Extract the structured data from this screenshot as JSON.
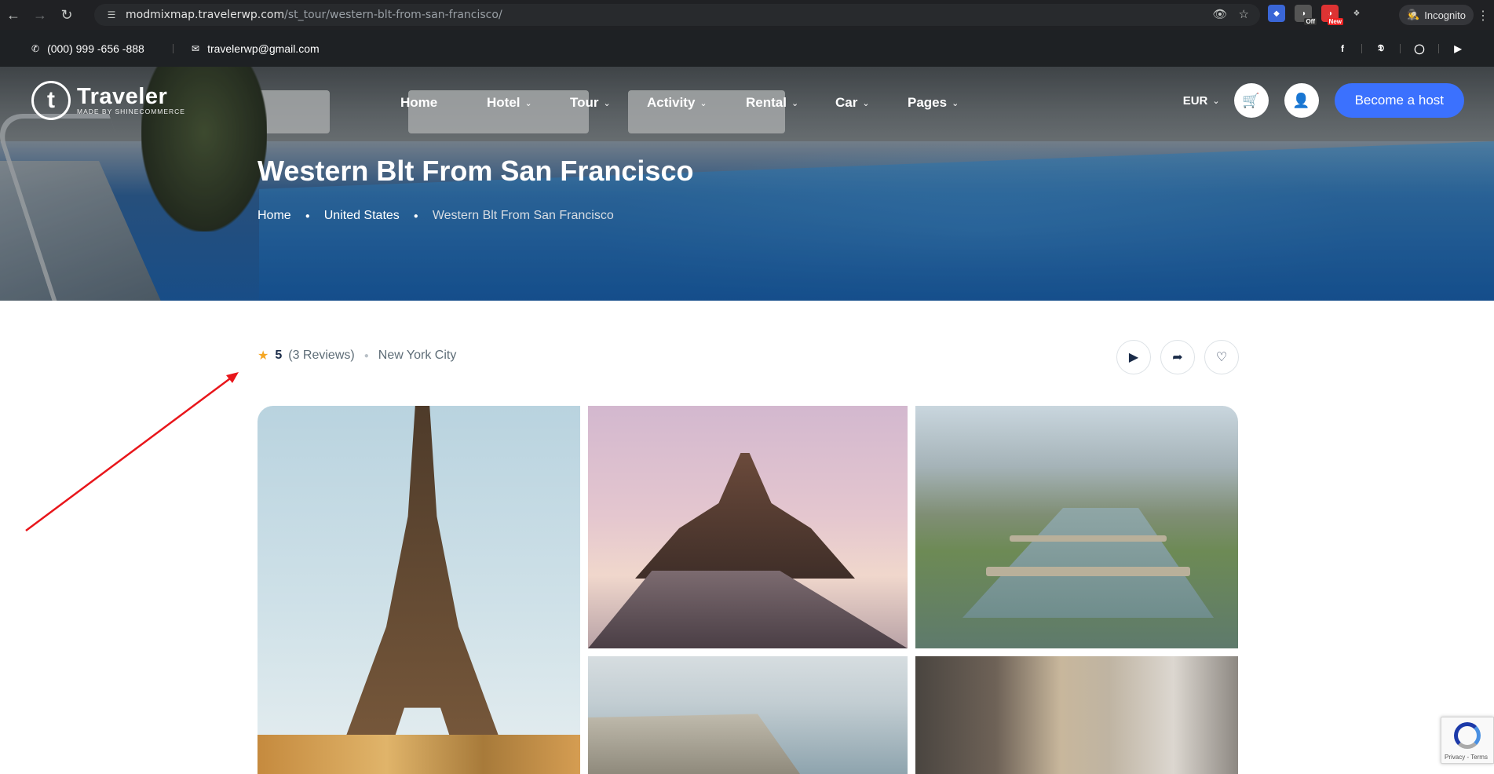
{
  "browser": {
    "url_host": "modmixmap.travelerwp.com",
    "url_path": "/st_tour/western-blt-from-san-francisco/",
    "incognito_label": "Incognito",
    "ext_off_badge": "Off",
    "ext_new_badge": "New"
  },
  "topbar": {
    "phone": "(000) 999 -656 -888",
    "email": "travelerwp@gmail.com"
  },
  "logo": {
    "name": "Traveler",
    "tagline": "MADE BY SHINECOMMERCE",
    "mark": "t"
  },
  "nav": {
    "items": [
      {
        "label": "Home",
        "has_dropdown": false
      },
      {
        "label": "Hotel",
        "has_dropdown": true
      },
      {
        "label": "Tour",
        "has_dropdown": true
      },
      {
        "label": "Activity",
        "has_dropdown": true
      },
      {
        "label": "Rental",
        "has_dropdown": true
      },
      {
        "label": "Car",
        "has_dropdown": true
      },
      {
        "label": "Pages",
        "has_dropdown": true
      }
    ],
    "currency": "EUR",
    "become_host": "Become a host"
  },
  "hero": {
    "title": "Western Blt From San Francisco",
    "breadcrumb": [
      "Home",
      "United States",
      "Western Blt From San Francisco"
    ]
  },
  "listing": {
    "rating": "5",
    "reviews": "(3 Reviews)",
    "location": "New York City"
  },
  "recaptcha": {
    "footer": "Privacy - Terms"
  },
  "colors": {
    "accent": "#3b71fe",
    "topbar_bg": "#1e2124",
    "star": "#f5a623",
    "annotation": "#e8161b"
  },
  "icons": {
    "phone": "phone-icon",
    "email": "email-icon",
    "social": [
      "facebook-icon",
      "twitter-icon",
      "instagram-icon",
      "youtube-icon"
    ],
    "actions": [
      "video-icon",
      "share-icon",
      "heart-icon"
    ]
  }
}
